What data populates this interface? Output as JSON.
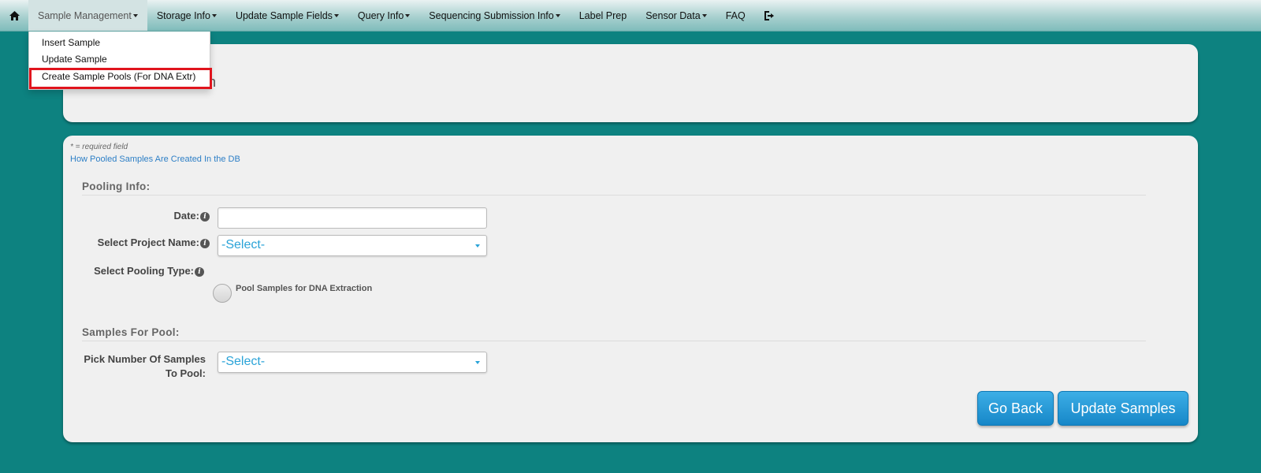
{
  "nav": {
    "items": [
      {
        "label": "Sample Management",
        "has_caret": true
      },
      {
        "label": "Storage Info",
        "has_caret": true
      },
      {
        "label": "Update Sample Fields",
        "has_caret": true
      },
      {
        "label": "Query Info",
        "has_caret": true
      },
      {
        "label": "Sequencing Submission Info",
        "has_caret": true
      },
      {
        "label": "Label Prep",
        "has_caret": false
      },
      {
        "label": "Sensor Data",
        "has_caret": true
      },
      {
        "label": "FAQ",
        "has_caret": false
      }
    ],
    "home_icon": "home-icon",
    "logout_icon": "logout-icon"
  },
  "dropdown": {
    "items": [
      {
        "label": "Insert Sample"
      },
      {
        "label": "Update Sample"
      },
      {
        "label": "Create Sample Pools (For DNA Extr)"
      }
    ],
    "highlight_color": "#e0141d"
  },
  "top_panel": {
    "title_fragment": "n"
  },
  "form": {
    "required_note": "* = required field",
    "help_link": "How Pooled Samples Are Created In the DB",
    "pooling_section": "Pooling Info:",
    "date_label": "Date:",
    "date_value": "",
    "project_label": "Select Project Name:",
    "project_value": "-Select-",
    "pooling_type_label": "Select Pooling Type:",
    "pooling_option": "Pool Samples for DNA Extraction",
    "samples_section": "Samples For Pool:",
    "num_samples_label_1": "Pick Number Of Samples",
    "num_samples_label_2": "To Pool:",
    "num_samples_value": "-Select-"
  },
  "buttons": {
    "back": "Go Back",
    "update": "Update Samples"
  },
  "colors": {
    "background": "#0d8280",
    "button": "#1e96d4",
    "select_text": "#2aa3d8",
    "link": "#2d7fc6"
  }
}
